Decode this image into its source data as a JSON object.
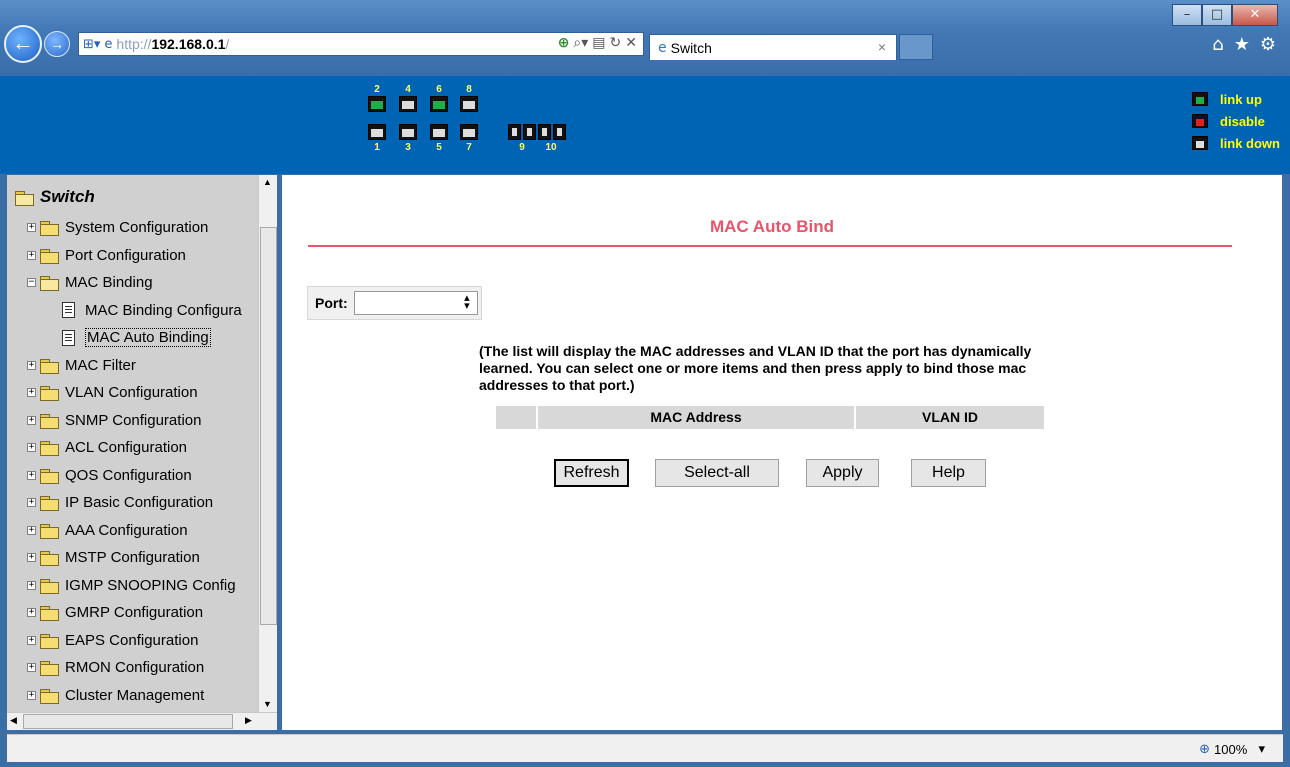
{
  "browser": {
    "address_proto": "http://",
    "address_host": "192.168.0.1",
    "address_slash": "/",
    "tab_title": "Switch",
    "zoom": "100%"
  },
  "device": {
    "top_numbers": [
      "2",
      "4",
      "6",
      "8"
    ],
    "bottom_numbers": [
      "1",
      "3",
      "5",
      "7"
    ],
    "sfp_numbers": [
      "9",
      "10"
    ],
    "port_status": {
      "1": "down",
      "2": "up",
      "3": "down",
      "4": "down",
      "5": "down",
      "6": "up",
      "7": "down",
      "8": "down"
    },
    "legend": [
      {
        "label": "link up",
        "status": "up"
      },
      {
        "label": "disable",
        "status": "disabled"
      },
      {
        "label": "link down",
        "status": "down"
      }
    ],
    "colors": {
      "link_up": "#1db04a",
      "disable": "#e32020",
      "link_down": "#dddddd",
      "banner": "#0064b4"
    }
  },
  "sidebar": {
    "root": "Switch",
    "items": [
      {
        "label": "System Configuration",
        "type": "folder",
        "expander": "+"
      },
      {
        "label": "Port Configuration",
        "type": "folder",
        "expander": "+"
      },
      {
        "label": "MAC Binding",
        "type": "folder-open",
        "expander": "−"
      },
      {
        "label": "MAC Binding Configura",
        "type": "doc"
      },
      {
        "label": "MAC Auto Binding",
        "type": "doc",
        "selected": true
      },
      {
        "label": "MAC Filter",
        "type": "folder",
        "expander": "+"
      },
      {
        "label": "VLAN Configuration",
        "type": "folder",
        "expander": "+"
      },
      {
        "label": "SNMP Configuration",
        "type": "folder",
        "expander": "+"
      },
      {
        "label": "ACL Configuration",
        "type": "folder",
        "expander": "+"
      },
      {
        "label": "QOS Configuration",
        "type": "folder",
        "expander": "+"
      },
      {
        "label": "IP Basic Configuration",
        "type": "folder",
        "expander": "+"
      },
      {
        "label": "AAA Configuration",
        "type": "folder",
        "expander": "+"
      },
      {
        "label": "MSTP Configuration",
        "type": "folder",
        "expander": "+"
      },
      {
        "label": "IGMP SNOOPING Config",
        "type": "folder",
        "expander": "+"
      },
      {
        "label": "GMRP Configuration",
        "type": "folder",
        "expander": "+"
      },
      {
        "label": "EAPS Configuration",
        "type": "folder",
        "expander": "+"
      },
      {
        "label": "RMON Configuration",
        "type": "folder",
        "expander": "+"
      },
      {
        "label": "Cluster Management",
        "type": "folder",
        "expander": "+"
      }
    ]
  },
  "main": {
    "title": "MAC Auto Bind",
    "port_label": "Port:",
    "port_value": "",
    "description": "(The list will display the MAC addresses and VLAN ID that the port has dynamically learned. You can select one or more items and then press apply to bind those mac addresses to that port.)",
    "table_headers": [
      "",
      "MAC Address",
      "VLAN ID"
    ],
    "buttons": {
      "refresh": "Refresh",
      "select_all": "Select-all",
      "apply": "Apply",
      "help": "Help"
    },
    "accent": "#e8546a"
  }
}
